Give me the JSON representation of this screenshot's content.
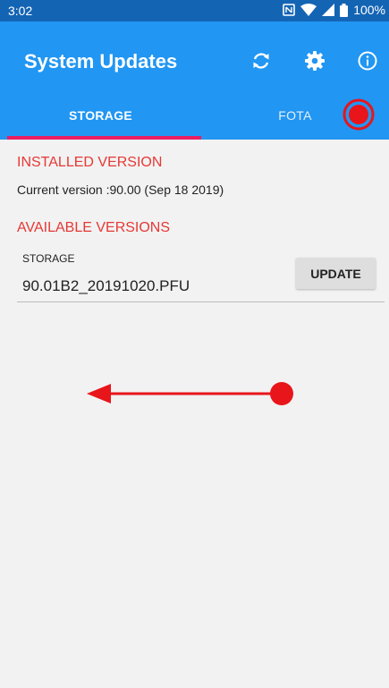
{
  "status_bar": {
    "time": "3:02",
    "battery": "100%",
    "icons": [
      "nfc-icon",
      "wifi-icon",
      "signal-icon",
      "battery-icon"
    ]
  },
  "app_bar": {
    "title": "System Updates",
    "actions": [
      "refresh-icon",
      "gear-icon",
      "info-icon"
    ]
  },
  "tabs": [
    {
      "label": "STORAGE",
      "selected": true
    },
    {
      "label": "FOTA",
      "selected": false
    }
  ],
  "installed": {
    "heading": "INSTALLED VERSION",
    "current_version": "Current version :90.00 (Sep 18 2019)"
  },
  "available": {
    "heading": "AVAILABLE VERSIONS",
    "items": [
      {
        "source": "STORAGE",
        "filename": "90.01B2_20191020.PFU",
        "button": "UPDATE"
      }
    ]
  },
  "colors": {
    "status_bar": "#1464b4",
    "app_bar": "#2196f3",
    "tab_indicator": "#e91e63",
    "section_heading": "#e53935",
    "overlay_annotation": "#e8151b"
  }
}
